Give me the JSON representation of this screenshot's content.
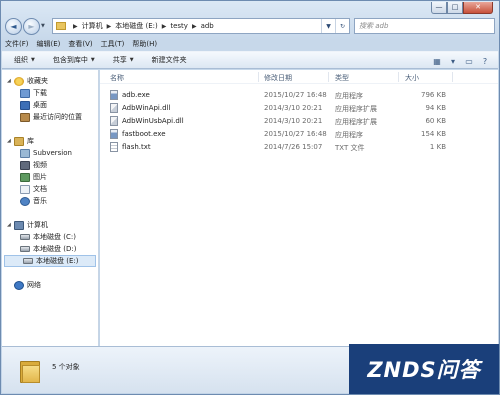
{
  "window": {
    "controls": {
      "minimize": "—",
      "maximize": "□",
      "close": "✕"
    }
  },
  "address_bar": {
    "back_glyph": "◄",
    "forward_glyph": "►",
    "crumbs": [
      "计算机",
      "本地磁盘 (E:)",
      "testy",
      "adb"
    ],
    "search_placeholder": "搜索 adb"
  },
  "menu": [
    "文件(F)",
    "编辑(E)",
    "查看(V)",
    "工具(T)",
    "帮助(H)"
  ],
  "commands": {
    "organize": "组织",
    "include_in_library": "包含到库中",
    "share": "共享",
    "new_folder": "新建文件夹"
  },
  "nav": {
    "favorites": {
      "label": "收藏夹",
      "items": [
        "下载",
        "桌面",
        "最近访问的位置"
      ]
    },
    "libraries": {
      "label": "库",
      "items": [
        "Subversion",
        "视频",
        "图片",
        "文档",
        "音乐"
      ]
    },
    "computer": {
      "label": "计算机",
      "items": [
        "本地磁盘 (C:)",
        "本地磁盘 (D:)",
        "本地磁盘 (E:)"
      ]
    },
    "network": {
      "label": "网络"
    }
  },
  "columns": {
    "name": "名称",
    "date": "修改日期",
    "type": "类型",
    "size": "大小"
  },
  "files": [
    {
      "name": "adb.exe",
      "date": "2015/10/27 16:48",
      "type": "应用程序",
      "size": "796 KB",
      "icon": "exe-icon"
    },
    {
      "name": "AdbWinApi.dll",
      "date": "2014/3/10 20:21",
      "type": "应用程序扩展",
      "size": "94 KB",
      "icon": "dll-icon"
    },
    {
      "name": "AdbWinUsbApi.dll",
      "date": "2014/3/10 20:21",
      "type": "应用程序扩展",
      "size": "60 KB",
      "icon": "dll-icon"
    },
    {
      "name": "fastboot.exe",
      "date": "2015/10/27 16:48",
      "type": "应用程序",
      "size": "154 KB",
      "icon": "exe-icon"
    },
    {
      "name": "flash.txt",
      "date": "2014/7/26 15:07",
      "type": "TXT 文件",
      "size": "1 KB",
      "icon": "txt-icon"
    }
  ],
  "status": {
    "count": "5 个对象"
  },
  "watermark": {
    "text": "ZNDS问答"
  }
}
